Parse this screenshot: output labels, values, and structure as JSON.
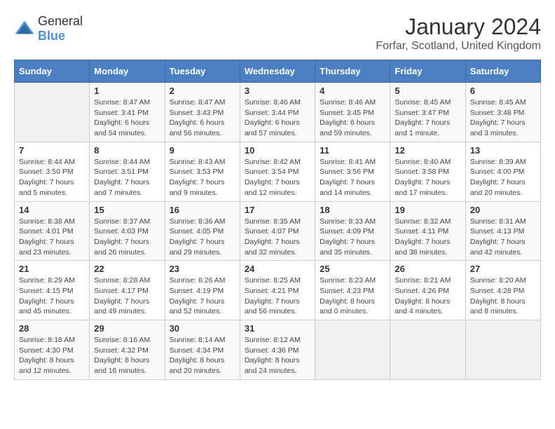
{
  "logo": {
    "general": "General",
    "blue": "Blue"
  },
  "title": "January 2024",
  "subtitle": "Forfar, Scotland, United Kingdom",
  "days_of_week": [
    "Sunday",
    "Monday",
    "Tuesday",
    "Wednesday",
    "Thursday",
    "Friday",
    "Saturday"
  ],
  "weeks": [
    [
      {
        "day": "",
        "sunrise": "",
        "sunset": "",
        "daylight": "",
        "empty": true
      },
      {
        "day": "1",
        "sunrise": "Sunrise: 8:47 AM",
        "sunset": "Sunset: 3:41 PM",
        "daylight": "Daylight: 6 hours and 54 minutes."
      },
      {
        "day": "2",
        "sunrise": "Sunrise: 8:47 AM",
        "sunset": "Sunset: 3:43 PM",
        "daylight": "Daylight: 6 hours and 56 minutes."
      },
      {
        "day": "3",
        "sunrise": "Sunrise: 8:46 AM",
        "sunset": "Sunset: 3:44 PM",
        "daylight": "Daylight: 6 hours and 57 minutes."
      },
      {
        "day": "4",
        "sunrise": "Sunrise: 8:46 AM",
        "sunset": "Sunset: 3:45 PM",
        "daylight": "Daylight: 6 hours and 59 minutes."
      },
      {
        "day": "5",
        "sunrise": "Sunrise: 8:45 AM",
        "sunset": "Sunset: 3:47 PM",
        "daylight": "Daylight: 7 hours and 1 minute."
      },
      {
        "day": "6",
        "sunrise": "Sunrise: 8:45 AM",
        "sunset": "Sunset: 3:48 PM",
        "daylight": "Daylight: 7 hours and 3 minutes."
      }
    ],
    [
      {
        "day": "7",
        "sunrise": "Sunrise: 8:44 AM",
        "sunset": "Sunset: 3:50 PM",
        "daylight": "Daylight: 7 hours and 5 minutes."
      },
      {
        "day": "8",
        "sunrise": "Sunrise: 8:44 AM",
        "sunset": "Sunset: 3:51 PM",
        "daylight": "Daylight: 7 hours and 7 minutes."
      },
      {
        "day": "9",
        "sunrise": "Sunrise: 8:43 AM",
        "sunset": "Sunset: 3:53 PM",
        "daylight": "Daylight: 7 hours and 9 minutes."
      },
      {
        "day": "10",
        "sunrise": "Sunrise: 8:42 AM",
        "sunset": "Sunset: 3:54 PM",
        "daylight": "Daylight: 7 hours and 12 minutes."
      },
      {
        "day": "11",
        "sunrise": "Sunrise: 8:41 AM",
        "sunset": "Sunset: 3:56 PM",
        "daylight": "Daylight: 7 hours and 14 minutes."
      },
      {
        "day": "12",
        "sunrise": "Sunrise: 8:40 AM",
        "sunset": "Sunset: 3:58 PM",
        "daylight": "Daylight: 7 hours and 17 minutes."
      },
      {
        "day": "13",
        "sunrise": "Sunrise: 8:39 AM",
        "sunset": "Sunset: 4:00 PM",
        "daylight": "Daylight: 7 hours and 20 minutes."
      }
    ],
    [
      {
        "day": "14",
        "sunrise": "Sunrise: 8:38 AM",
        "sunset": "Sunset: 4:01 PM",
        "daylight": "Daylight: 7 hours and 23 minutes."
      },
      {
        "day": "15",
        "sunrise": "Sunrise: 8:37 AM",
        "sunset": "Sunset: 4:03 PM",
        "daylight": "Daylight: 7 hours and 26 minutes."
      },
      {
        "day": "16",
        "sunrise": "Sunrise: 8:36 AM",
        "sunset": "Sunset: 4:05 PM",
        "daylight": "Daylight: 7 hours and 29 minutes."
      },
      {
        "day": "17",
        "sunrise": "Sunrise: 8:35 AM",
        "sunset": "Sunset: 4:07 PM",
        "daylight": "Daylight: 7 hours and 32 minutes."
      },
      {
        "day": "18",
        "sunrise": "Sunrise: 8:33 AM",
        "sunset": "Sunset: 4:09 PM",
        "daylight": "Daylight: 7 hours and 35 minutes."
      },
      {
        "day": "19",
        "sunrise": "Sunrise: 8:32 AM",
        "sunset": "Sunset: 4:11 PM",
        "daylight": "Daylight: 7 hours and 38 minutes."
      },
      {
        "day": "20",
        "sunrise": "Sunrise: 8:31 AM",
        "sunset": "Sunset: 4:13 PM",
        "daylight": "Daylight: 7 hours and 42 minutes."
      }
    ],
    [
      {
        "day": "21",
        "sunrise": "Sunrise: 8:29 AM",
        "sunset": "Sunset: 4:15 PM",
        "daylight": "Daylight: 7 hours and 45 minutes."
      },
      {
        "day": "22",
        "sunrise": "Sunrise: 8:28 AM",
        "sunset": "Sunset: 4:17 PM",
        "daylight": "Daylight: 7 hours and 49 minutes."
      },
      {
        "day": "23",
        "sunrise": "Sunrise: 8:26 AM",
        "sunset": "Sunset: 4:19 PM",
        "daylight": "Daylight: 7 hours and 52 minutes."
      },
      {
        "day": "24",
        "sunrise": "Sunrise: 8:25 AM",
        "sunset": "Sunset: 4:21 PM",
        "daylight": "Daylight: 7 hours and 56 minutes."
      },
      {
        "day": "25",
        "sunrise": "Sunrise: 8:23 AM",
        "sunset": "Sunset: 4:23 PM",
        "daylight": "Daylight: 8 hours and 0 minutes."
      },
      {
        "day": "26",
        "sunrise": "Sunrise: 8:21 AM",
        "sunset": "Sunset: 4:26 PM",
        "daylight": "Daylight: 8 hours and 4 minutes."
      },
      {
        "day": "27",
        "sunrise": "Sunrise: 8:20 AM",
        "sunset": "Sunset: 4:28 PM",
        "daylight": "Daylight: 8 hours and 8 minutes."
      }
    ],
    [
      {
        "day": "28",
        "sunrise": "Sunrise: 8:18 AM",
        "sunset": "Sunset: 4:30 PM",
        "daylight": "Daylight: 8 hours and 12 minutes."
      },
      {
        "day": "29",
        "sunrise": "Sunrise: 8:16 AM",
        "sunset": "Sunset: 4:32 PM",
        "daylight": "Daylight: 8 hours and 16 minutes."
      },
      {
        "day": "30",
        "sunrise": "Sunrise: 8:14 AM",
        "sunset": "Sunset: 4:34 PM",
        "daylight": "Daylight: 8 hours and 20 minutes."
      },
      {
        "day": "31",
        "sunrise": "Sunrise: 8:12 AM",
        "sunset": "Sunset: 4:36 PM",
        "daylight": "Daylight: 8 hours and 24 minutes."
      },
      {
        "day": "",
        "sunrise": "",
        "sunset": "",
        "daylight": "",
        "empty": true
      },
      {
        "day": "",
        "sunrise": "",
        "sunset": "",
        "daylight": "",
        "empty": true
      },
      {
        "day": "",
        "sunrise": "",
        "sunset": "",
        "daylight": "",
        "empty": true
      }
    ]
  ]
}
